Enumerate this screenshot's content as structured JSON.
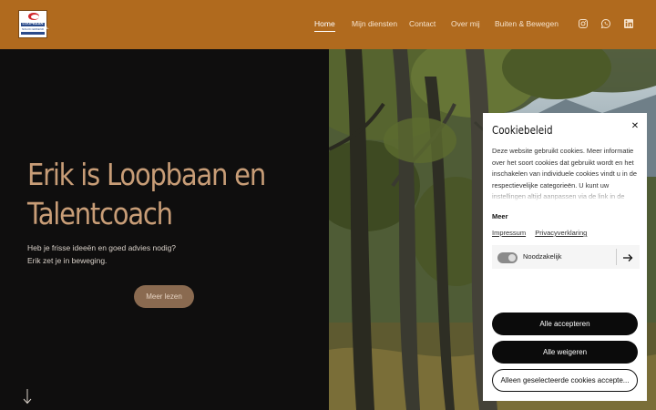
{
  "header": {
    "logo_alt": "LOOPBAAN PROFESSIONAL",
    "logo_line2": "NOLOC ERKEND",
    "nav": [
      {
        "label": "Home",
        "active": true
      },
      {
        "label": "Mijn diensten",
        "active": false
      },
      {
        "label": "Contact",
        "active": false
      },
      {
        "label": "Over mij",
        "active": false
      },
      {
        "label": "Buiten & Bewegen",
        "active": false
      }
    ],
    "social_icons": [
      "instagram-icon",
      "whatsapp-icon",
      "linkedin-icon"
    ]
  },
  "hero": {
    "title": "Erik is Loopbaan en Talentcoach",
    "subtitle_line1": "Heb je frisse ideeën en goed advies nodig?",
    "subtitle_line2": "Erik zet je in beweging.",
    "cta_label": "Meer lezen"
  },
  "cookie": {
    "title": "Cookiebeleid",
    "text": "Deze website gebruikt cookies. Meer informatie over het soort cookies dat gebruikt wordt en het inschakelen van individuele cookies vindt u in de respectievelijke categorieën. U kunt uw instellingen altijd aanpassen via de link in de",
    "more_label": "Meer",
    "links": [
      "Impressum",
      "Privacyverklaring"
    ],
    "category_label": "Noodzakelijk",
    "accept_all": "Alle accepteren",
    "reject_all": "Alle weigeren",
    "accept_selected": "Alleen geselecteerde cookies accepte..."
  },
  "colors": {
    "header_bg": "#b06a1e",
    "hero_bg": "#0f0e0e",
    "hero_title": "#c89d77",
    "cta_bg": "#8a6a50"
  }
}
